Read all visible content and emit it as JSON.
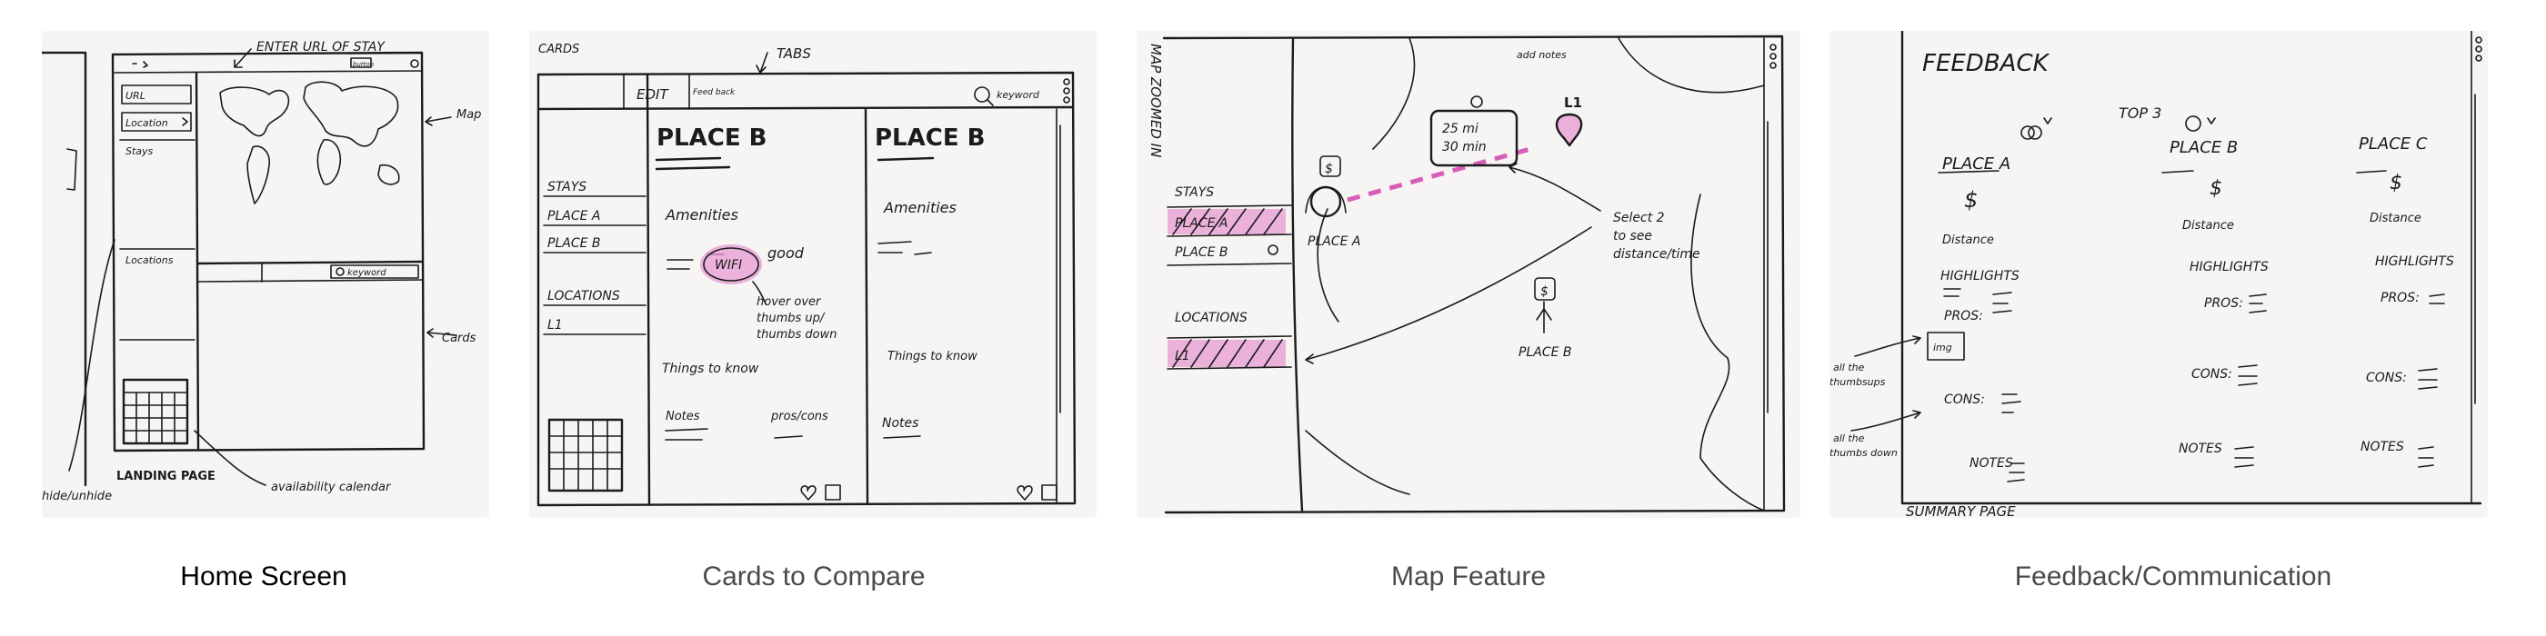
{
  "captions": [
    {
      "label": "Home Screen"
    },
    {
      "label": "Cards to Compare"
    },
    {
      "label": "Map Feature"
    },
    {
      "label": "Feedback/Communication"
    }
  ],
  "sketch1": {
    "enter_url": "ENTER URL OF STAY",
    "url_field": "URL",
    "location_field": "Location",
    "stays": "Stays",
    "locations": "Locations",
    "map": "Map",
    "cards": "Cards",
    "landing_page": "LANDING PAGE",
    "availability_calendar": "availability calendar",
    "hide_unhide": "hide/unhide",
    "keyword": "keyword",
    "button": "button"
  },
  "sketch2": {
    "cards_label": "CARDS",
    "tabs_label": "TABS",
    "tab_edit": "EDIT",
    "tab_feedback": "Feed back",
    "keyword": "keyword",
    "stays": "STAYS",
    "place_a": "PLACE A",
    "place_b_nav": "PLACE B",
    "locations": "LOCATIONS",
    "l1": "L1",
    "card1_title": "PLACE B",
    "card2_title": "PLACE B",
    "amenities1": "Amenities",
    "amenities2": "Amenities",
    "wifi": "WIFI",
    "good": "good",
    "hover_note": "hover over thumbs up/ thumbs down",
    "things_to_know1": "Things to know",
    "things_to_know2": "Things to know",
    "notes1": "Notes",
    "pros_cons": "pros/cons",
    "notes2": "Notes"
  },
  "sketch3": {
    "side_label": "MAP ZOOMED IN",
    "stays": "STAYS",
    "place_a_nav": "PLACE A",
    "place_b_nav": "PLACE B",
    "locations": "LOCATIONS",
    "l1_nav": "L1",
    "add_notes": "add notes",
    "distance_bubble": "25 mi 30 min",
    "l1_marker": "L1",
    "dollar": "$",
    "place_a": "PLACE A",
    "place_b": "PLACE B",
    "select2": "Select 2 to see distance/time"
  },
  "sketch4": {
    "title": "FEEDBACK",
    "top3": "TOP 3",
    "place_a": "PLACE A",
    "place_b": "PLACE B",
    "place_c": "PLACE C",
    "dollar": "$",
    "distance": "Distance",
    "highlights": "HIGHLIGHTS",
    "pros": "PROS:",
    "cons": "CONS:",
    "notes": "NOTES",
    "img": "img",
    "thumbs_up_note": "all the thumbsups",
    "thumbs_down_note": "all the thumbs down",
    "summary": "SUMMARY PAGE"
  },
  "colors": {
    "highlight": "#e79ad3",
    "ink": "#1b1b1b",
    "paper": "#f6f5f3"
  }
}
